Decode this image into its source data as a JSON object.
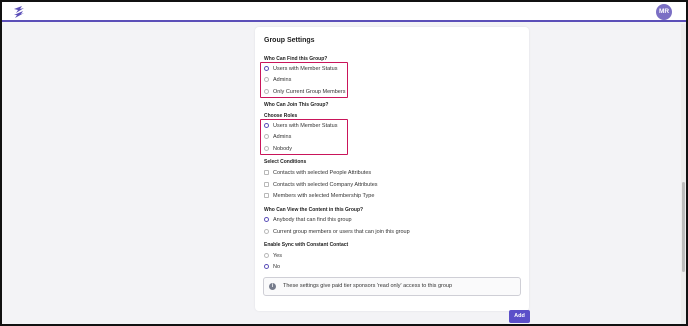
{
  "header": {
    "avatar_initials": "MR",
    "accent": "#5b4fb8"
  },
  "group_settings": {
    "title": "Group Settings",
    "find": {
      "label": "Who Can Find this Group?",
      "options": [
        "Users with Member Status",
        "Admins",
        "Only Current Group Members"
      ],
      "selected": "Users with Member Status"
    },
    "join": {
      "label": "Who Can Join This Group?",
      "sub_label": "Choose Roles",
      "options": [
        "Users with Member Status",
        "Admins",
        "Nobody"
      ],
      "selected": "Users with Member Status"
    },
    "conditions": {
      "label": "Select Conditions",
      "options": [
        "Contacts with selected People Attributes",
        "Contacts with selected Company Attributes",
        "Members with selected Membership Type"
      ]
    },
    "view": {
      "label": "Who Can View the Content in this Group?",
      "options": [
        "Anybody that can find this group",
        "Current group members or users that can join this group"
      ],
      "selected": "Anybody that can find this group"
    },
    "sync": {
      "label": "Enable Sync with Constant Contact",
      "options": [
        "Yes",
        "No"
      ],
      "selected": "No"
    },
    "info": "These settings give paid tier sponsors 'read only' access to this group",
    "add_label": "Add"
  },
  "highlight_color": "#c9155a"
}
